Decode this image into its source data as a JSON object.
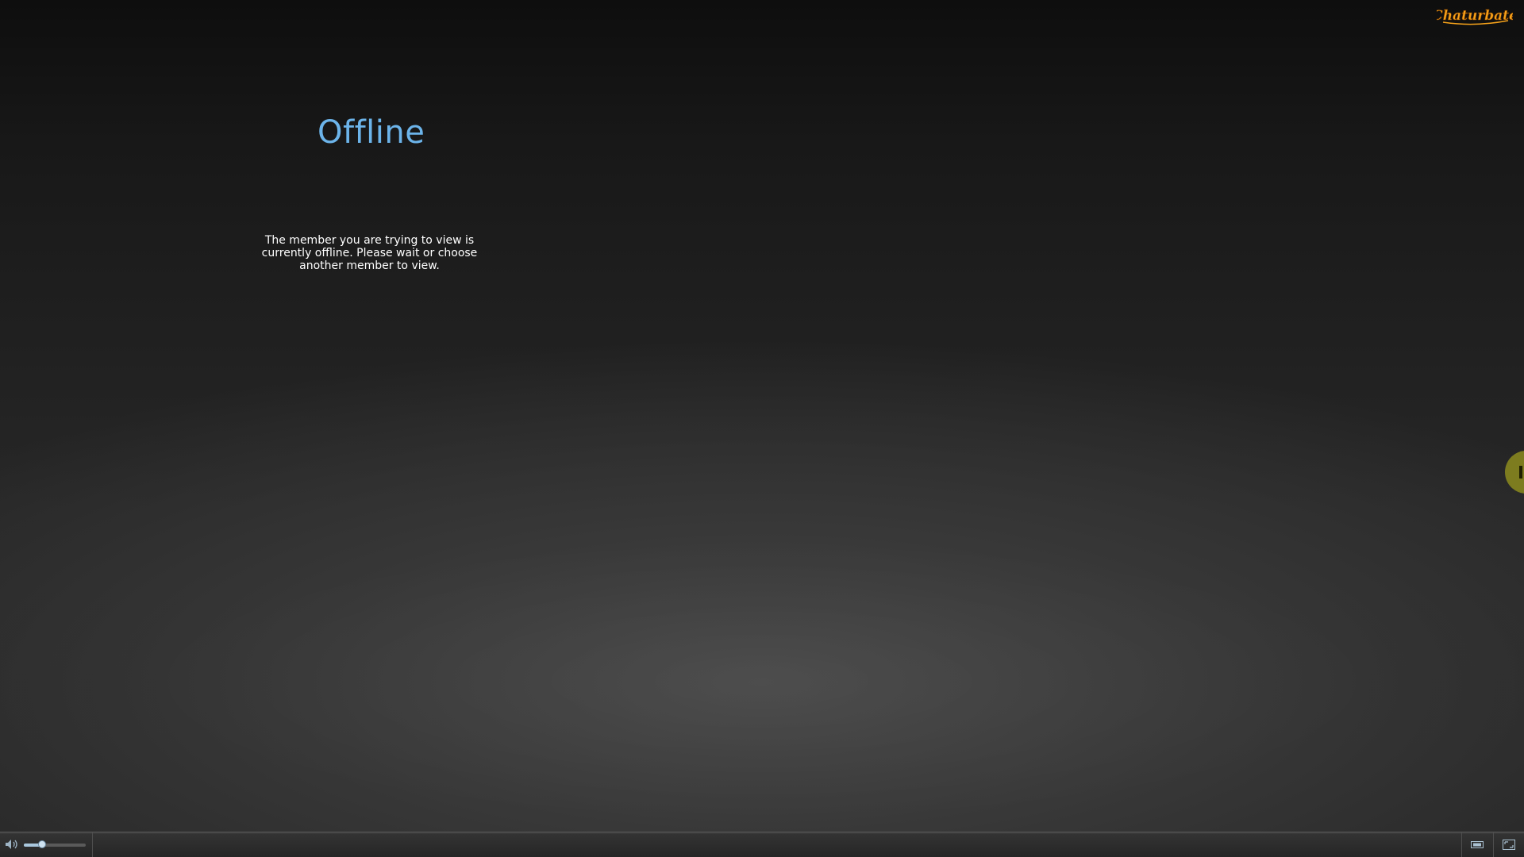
{
  "brand": {
    "logo_text": "Chaturbate"
  },
  "status": {
    "title": "Offline",
    "message": "The member you are trying to view is currently offline. Please wait or choose another member to view."
  },
  "controls": {
    "volume_level": 0.3,
    "icons": [
      "speaker-icon",
      "theater-mode-icon",
      "fullscreen-icon",
      "chevron-left-icon"
    ]
  },
  "colors": {
    "title": "#6cb4ea",
    "side_tab": "#7d7c1f",
    "logo_orange": "#f6a21a"
  }
}
